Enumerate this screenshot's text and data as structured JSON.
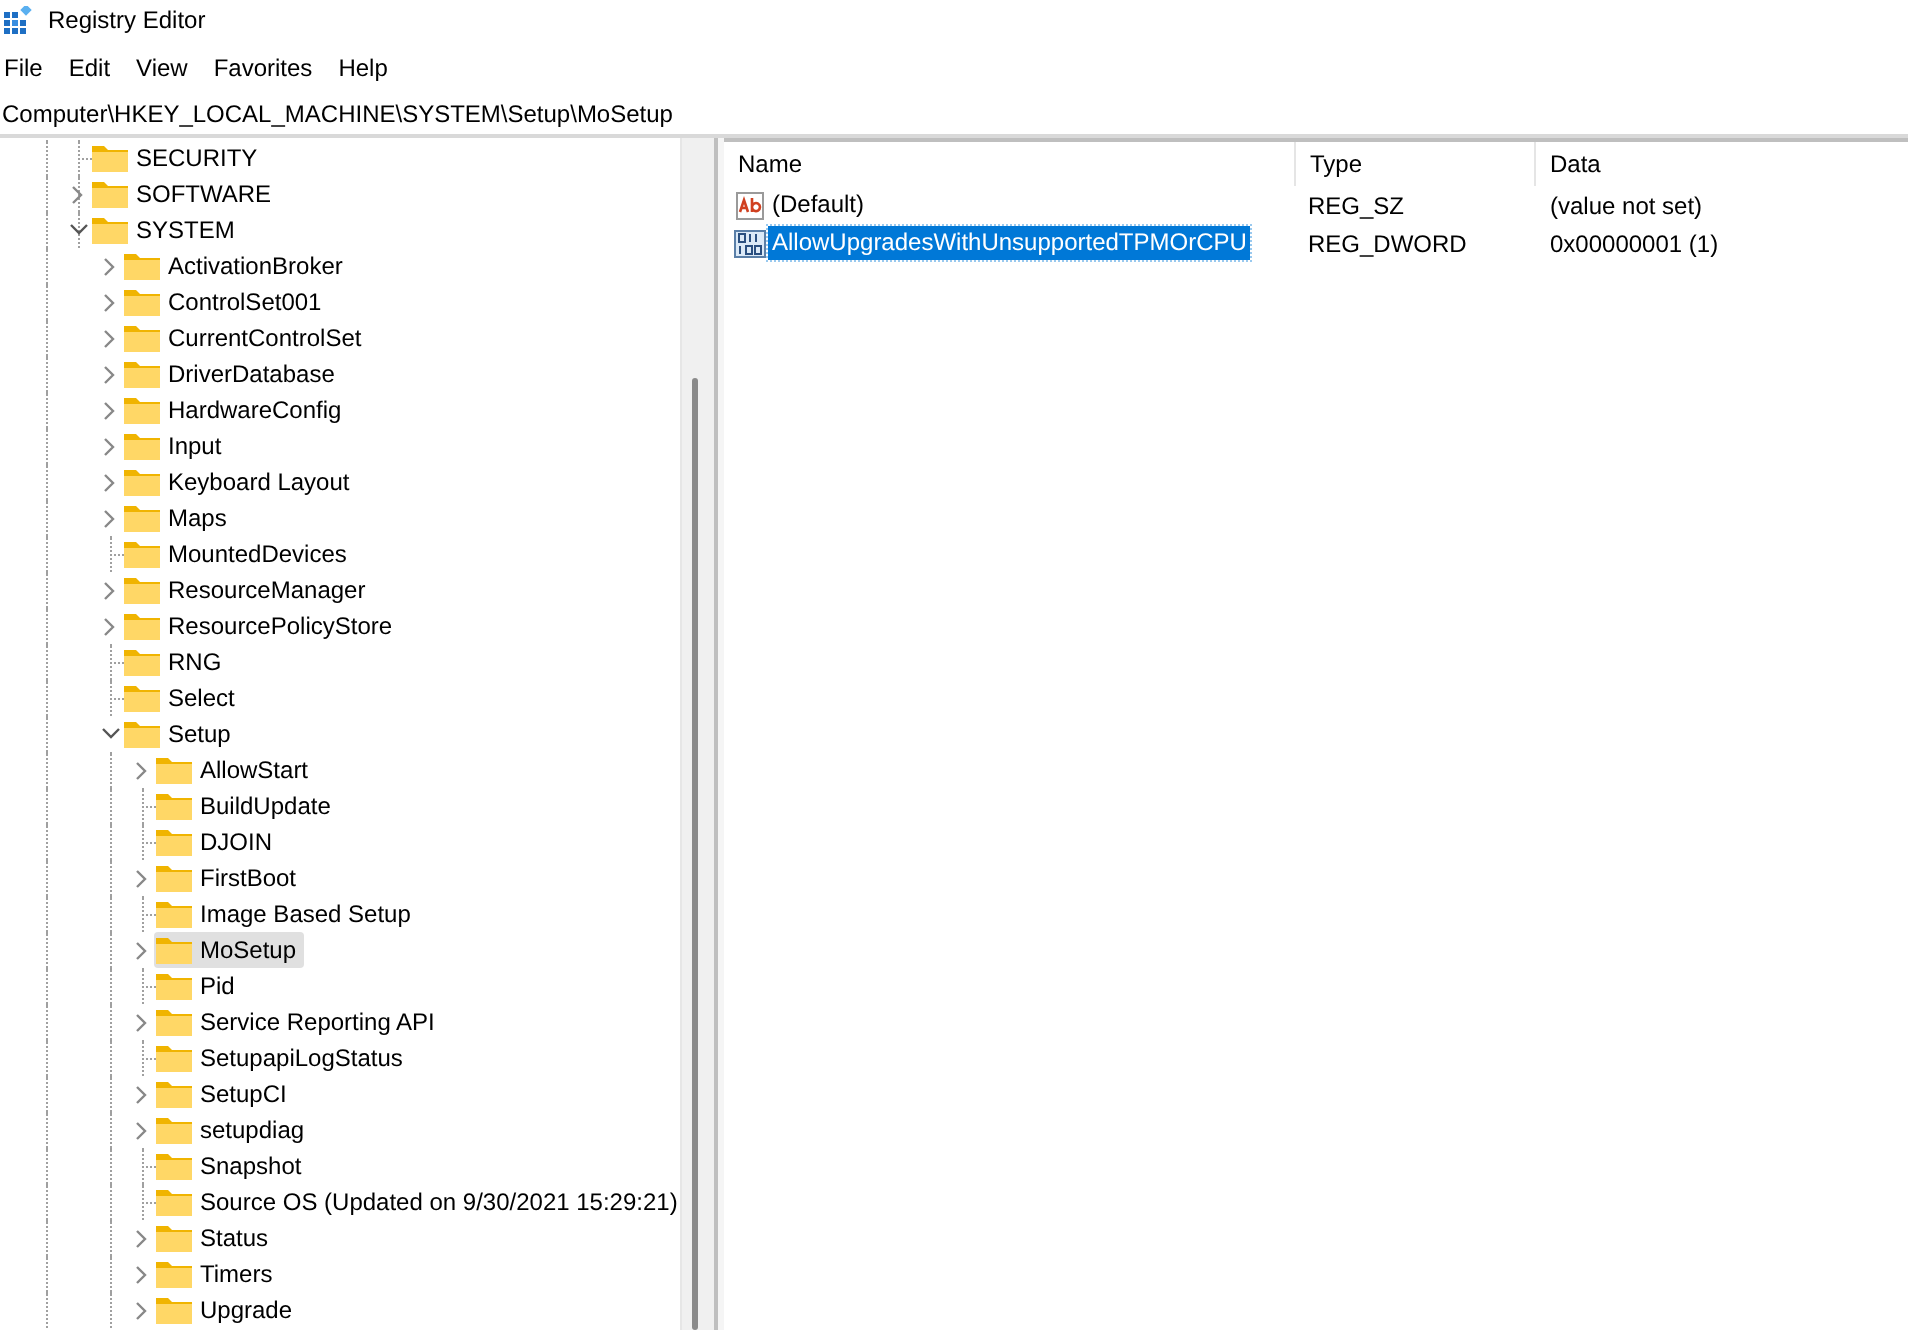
{
  "window": {
    "title": "Registry Editor"
  },
  "menu": [
    "File",
    "Edit",
    "View",
    "Favorites",
    "Help"
  ],
  "address": "Computer\\HKEY_LOCAL_MACHINE\\SYSTEM\\Setup\\MoSetup",
  "tree": [
    {
      "label": "SECURITY",
      "expandable": false,
      "selected": false
    },
    {
      "label": "SOFTWARE",
      "expandable": true,
      "expanded": false,
      "selected": false
    },
    {
      "label": "SYSTEM",
      "expandable": true,
      "expanded": true,
      "selected": false,
      "children": [
        {
          "label": "ActivationBroker",
          "expandable": true,
          "expanded": false,
          "selected": false
        },
        {
          "label": "ControlSet001",
          "expandable": true,
          "expanded": false,
          "selected": false
        },
        {
          "label": "CurrentControlSet",
          "expandable": true,
          "expanded": false,
          "selected": false
        },
        {
          "label": "DriverDatabase",
          "expandable": true,
          "expanded": false,
          "selected": false
        },
        {
          "label": "HardwareConfig",
          "expandable": true,
          "expanded": false,
          "selected": false
        },
        {
          "label": "Input",
          "expandable": true,
          "expanded": false,
          "selected": false
        },
        {
          "label": "Keyboard Layout",
          "expandable": true,
          "expanded": false,
          "selected": false
        },
        {
          "label": "Maps",
          "expandable": true,
          "expanded": false,
          "selected": false
        },
        {
          "label": "MountedDevices",
          "expandable": false,
          "selected": false
        },
        {
          "label": "ResourceManager",
          "expandable": true,
          "expanded": false,
          "selected": false
        },
        {
          "label": "ResourcePolicyStore",
          "expandable": true,
          "expanded": false,
          "selected": false
        },
        {
          "label": "RNG",
          "expandable": false,
          "selected": false
        },
        {
          "label": "Select",
          "expandable": false,
          "selected": false
        },
        {
          "label": "Setup",
          "expandable": true,
          "expanded": true,
          "selected": false,
          "children": [
            {
              "label": "AllowStart",
              "expandable": true,
              "expanded": false,
              "selected": false
            },
            {
              "label": "BuildUpdate",
              "expandable": false,
              "selected": false
            },
            {
              "label": "DJOIN",
              "expandable": false,
              "selected": false
            },
            {
              "label": "FirstBoot",
              "expandable": true,
              "expanded": false,
              "selected": false
            },
            {
              "label": "Image Based Setup",
              "expandable": false,
              "selected": false
            },
            {
              "label": "MoSetup",
              "expandable": true,
              "expanded": false,
              "selected": true
            },
            {
              "label": "Pid",
              "expandable": false,
              "selected": false
            },
            {
              "label": "Service Reporting API",
              "expandable": true,
              "expanded": false,
              "selected": false
            },
            {
              "label": "SetupapiLogStatus",
              "expandable": false,
              "selected": false
            },
            {
              "label": "SetupCI",
              "expandable": true,
              "expanded": false,
              "selected": false
            },
            {
              "label": "setupdiag",
              "expandable": true,
              "expanded": false,
              "selected": false
            },
            {
              "label": "Snapshot",
              "expandable": false,
              "selected": false
            },
            {
              "label": "Source OS (Updated on 9/30/2021 15:29:21)",
              "expandable": false,
              "selected": false
            },
            {
              "label": "Status",
              "expandable": true,
              "expanded": false,
              "selected": false
            },
            {
              "label": "Timers",
              "expandable": true,
              "expanded": false,
              "selected": false
            },
            {
              "label": "Upgrade",
              "expandable": true,
              "expanded": false,
              "selected": false
            }
          ]
        }
      ]
    }
  ],
  "values": {
    "columns": [
      "Name",
      "Type",
      "Data"
    ],
    "rows": [
      {
        "kind": "string",
        "name": "(Default)",
        "type": "REG_SZ",
        "data": "(value not set)",
        "selected": false
      },
      {
        "kind": "dword",
        "name": "AllowUpgradesWithUnsupportedTPMOrCPU",
        "type": "REG_DWORD",
        "data": "0x00000001 (1)",
        "selected": true
      }
    ]
  }
}
